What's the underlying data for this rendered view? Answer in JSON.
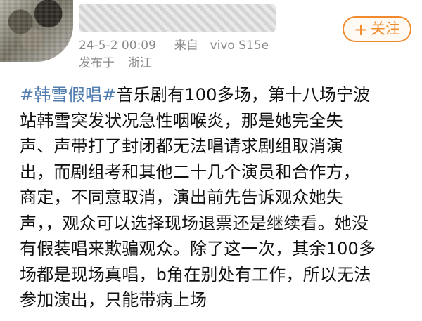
{
  "post": {
    "avatar_icon": "user-avatar",
    "follow_label": "关注",
    "follow_icon": "plus-icon",
    "meta": {
      "date_time": "24-5-2 00:09",
      "device_prefix": "来自",
      "device": "vivo S15e",
      "location_prefix": "发布于",
      "location": "浙江"
    },
    "content": {
      "hashtag": "#韩雪假唱#",
      "lines": [
        "音乐剧有100多场，第十八场宁波",
        "站韩雪突发状况急性咽喉炎，那是她完全失",
        "声、声带打了封闭都无法唱请求剧组取消演",
        "出，而剧组考和其他二十几个演员和合作方，",
        "商定，不同意取消，演出前先告诉观众她失",
        "声，，观众可以选择现场退票还是继续看。她没",
        "有假装唱来欺骗观众。除了这一次，其余100多",
        "场都是现场真唱，b角在别处有工作，所以无法",
        "参加演出，只能带病上场"
      ]
    }
  },
  "colors": {
    "accent": "#f08a2c",
    "hashtag": "#507daf",
    "meta_text": "#8a8a8a",
    "body_text": "#111111"
  }
}
